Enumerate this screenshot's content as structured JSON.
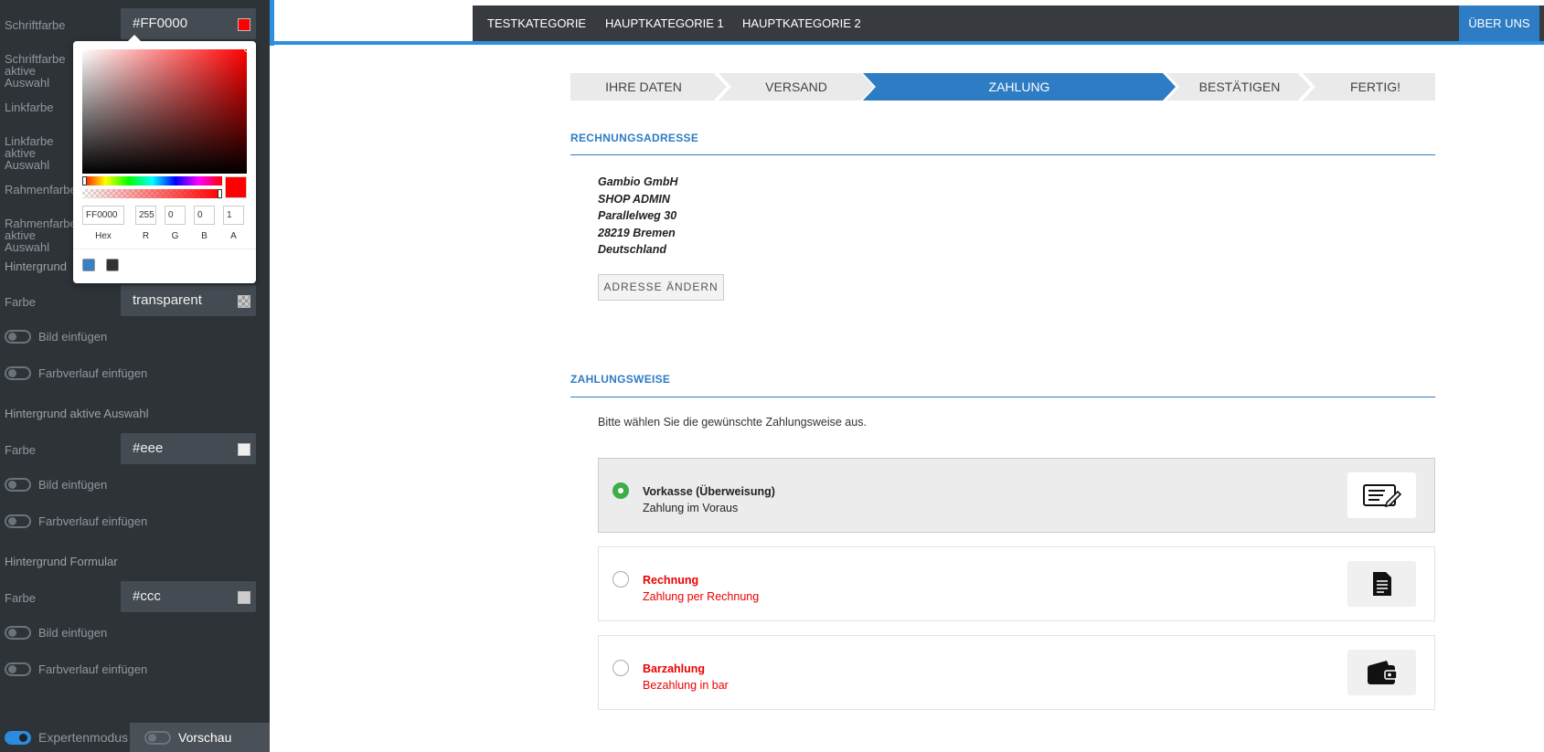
{
  "sidebar": {
    "fields": {
      "schriftfarbe": {
        "label": "Schriftfarbe",
        "value": "#FF0000",
        "swatch": "#ff0000"
      },
      "schriftfarbe_aktiv": {
        "label": "Schriftfarbe aktive Auswahl"
      },
      "linkfarbe": {
        "label": "Linkfarbe"
      },
      "linkfarbe_aktiv": {
        "label": "Linkfarbe aktive Auswahl"
      },
      "rahmenfarbe": {
        "label": "Rahmenfarbe"
      },
      "rahmenfarbe_aktiv": {
        "label": "Rahmenfarbe aktive Auswahl"
      }
    },
    "hintergrund": {
      "title": "Hintergrund",
      "farbe_label": "Farbe",
      "farbe_value": "transparent",
      "bild_label": "Bild einfügen",
      "verlauf_label": "Farbverlauf einfügen"
    },
    "hintergrund_aktiv": {
      "title": "Hintergrund aktive Auswahl",
      "farbe_label": "Farbe",
      "farbe_value": "#eee",
      "swatch": "#eeeeee",
      "bild_label": "Bild einfügen",
      "verlauf_label": "Farbverlauf einfügen"
    },
    "hintergrund_formular": {
      "title": "Hintergrund Formular",
      "farbe_label": "Farbe",
      "farbe_value": "#ccc",
      "swatch": "#cccccc",
      "bild_label": "Bild einfügen",
      "verlauf_label": "Farbverlauf einfügen"
    },
    "bottom": {
      "expert_label": "Expertenmodus",
      "preview_label": "Vorschau"
    }
  },
  "picker": {
    "hex": "FF0000",
    "r": "255",
    "g": "0",
    "b": "0",
    "a": "1",
    "labels": {
      "hex": "Hex",
      "r": "R",
      "g": "G",
      "b": "B",
      "a": "A"
    },
    "presets": [
      "#3a7ec3",
      "#333333"
    ]
  },
  "nav": {
    "items": [
      "TESTKATEGORIE",
      "HAUPTKATEGORIE 1",
      "HAUPTKATEGORIE 2"
    ],
    "about": "ÜBER UNS"
  },
  "steps": [
    "IHRE DATEN",
    "VERSAND",
    "ZAHLUNG",
    "BESTÄTIGEN",
    "FERTIG!"
  ],
  "billing": {
    "title": "RECHNUNGSADRESSE",
    "lines": [
      "Gambio GmbH",
      "SHOP ADMIN",
      "Parallelweg 30",
      "28219 Bremen",
      "Deutschland"
    ],
    "change_button": "ADRESSE ÄNDERN"
  },
  "payment": {
    "title": "ZAHLUNGSWEISE",
    "hint": "Bitte wählen Sie die gewünschte Zahlungsweise aus.",
    "methods": [
      {
        "name": "Vorkasse (Überweisung)",
        "desc": "Zahlung im Voraus",
        "icon": "prepayment-icon",
        "selected": true
      },
      {
        "name": "Rechnung",
        "desc": "Zahlung per Rechnung",
        "icon": "invoice-icon",
        "selected": false
      },
      {
        "name": "Barzahlung",
        "desc": "Bezahlung in bar",
        "icon": "wallet-icon",
        "selected": false
      }
    ]
  },
  "colors": {
    "accent": "#2d7cc4",
    "nav": "#373b3f",
    "sidebar": "#2e3338",
    "error": "#ee0000",
    "radio_on": "#3fae49"
  }
}
